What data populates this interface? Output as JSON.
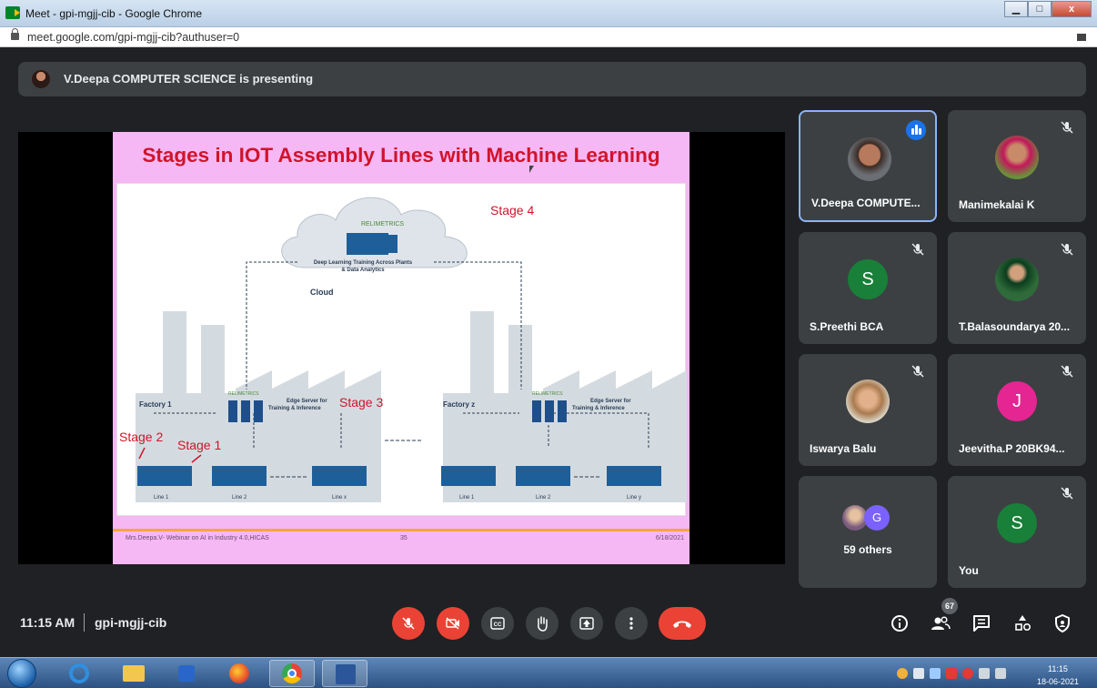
{
  "window": {
    "title": "Meet - gpi-mgjj-cib - Google Chrome",
    "url": "meet.google.com/gpi-mgjj-cib?authuser=0",
    "min_label": "▁",
    "max_label": "□",
    "close_label": "x"
  },
  "banner": {
    "text": "V.Deepa COMPUTER SCIENCE is presenting"
  },
  "slide": {
    "title": "Stages in IOT Assembly Lines with Machine Learning",
    "brand": "RELIMETRICS",
    "cloud_text_1": "Deep Learning Training Across Plants",
    "cloud_text_2": "& Data Analytics",
    "cloud_label": "Cloud",
    "stage4": "Stage 4",
    "stage3": "Stage 3",
    "stage2": "Stage 2",
    "stage1": "Stage 1",
    "factory1": "Factory 1",
    "factoryz": "Factory z",
    "edge_1": "Edge Server for",
    "edge_2": "Training & Inference",
    "line1": "Line 1",
    "line2": "Line 2",
    "linex": "Line x",
    "liney": "Line y",
    "footer_left": "Mrs.Deepa.V- Webinar on AI in Industry 4.0,HICAS",
    "footer_center": "35",
    "footer_right": "6/18/2021"
  },
  "participants": [
    {
      "name": "V.Deepa COMPUTE...",
      "kind": "photo",
      "speaking": true
    },
    {
      "name": "Manimekalai K",
      "kind": "photo",
      "muted": true
    },
    {
      "name": "S.Preethi BCA",
      "kind": "letter",
      "letter": "S",
      "color": "#188038",
      "muted": true
    },
    {
      "name": "T.Balasoundarya 20...",
      "kind": "photo",
      "muted": true
    },
    {
      "name": "Iswarya Balu",
      "kind": "photo",
      "muted": true
    },
    {
      "name": "Jeevitha.P 20BK94...",
      "kind": "letter",
      "letter": "J",
      "color": "#e52592",
      "muted": true
    },
    {
      "name": "59 others",
      "kind": "group",
      "letter": "G"
    },
    {
      "name": "You",
      "kind": "letter",
      "letter": "S",
      "color": "#188038",
      "muted": true
    }
  ],
  "bottom": {
    "time": "11:15 AM",
    "meeting_code": "gpi-mgjj-cib",
    "participant_count": "67",
    "icons": [
      "mic-off-icon",
      "camera-off-icon",
      "captions-icon",
      "raise-hand-icon",
      "present-icon",
      "more-options-icon",
      "end-call-icon",
      "info-icon",
      "people-icon",
      "chat-icon",
      "activities-icon",
      "host-controls-icon"
    ]
  },
  "taskbar": {
    "clock_time": "11:15",
    "clock_date": "18-06-2021"
  },
  "colors": {
    "meet_bg": "#202124",
    "tile_bg": "#3c4043",
    "red": "#ea4335",
    "slide_title": "#d0142b",
    "slide_bg": "#f6b7f5"
  }
}
